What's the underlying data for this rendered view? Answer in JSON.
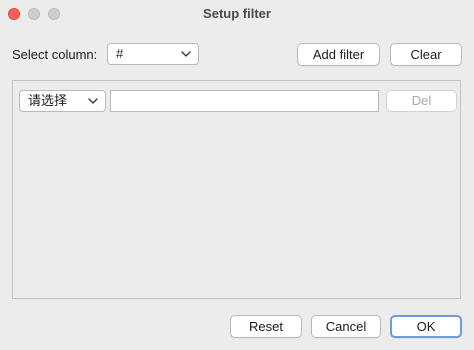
{
  "window": {
    "title": "Setup filter"
  },
  "toolbar": {
    "select_column_label": "Select column:",
    "column_value": "#",
    "add_filter_label": "Add filter",
    "clear_label": "Clear"
  },
  "filter_row": {
    "condition_value": "请选择",
    "value_text": "",
    "del_label": "Del"
  },
  "footer": {
    "reset_label": "Reset",
    "cancel_label": "Cancel",
    "ok_label": "OK"
  },
  "colors": {
    "close": "#ff5f57",
    "inactive_traffic": "#cfcfcf",
    "default_button_ring": "#6e9be0"
  },
  "icons": [
    "close-icon",
    "minimize-icon",
    "zoom-icon",
    "chevron-down-icon"
  ]
}
